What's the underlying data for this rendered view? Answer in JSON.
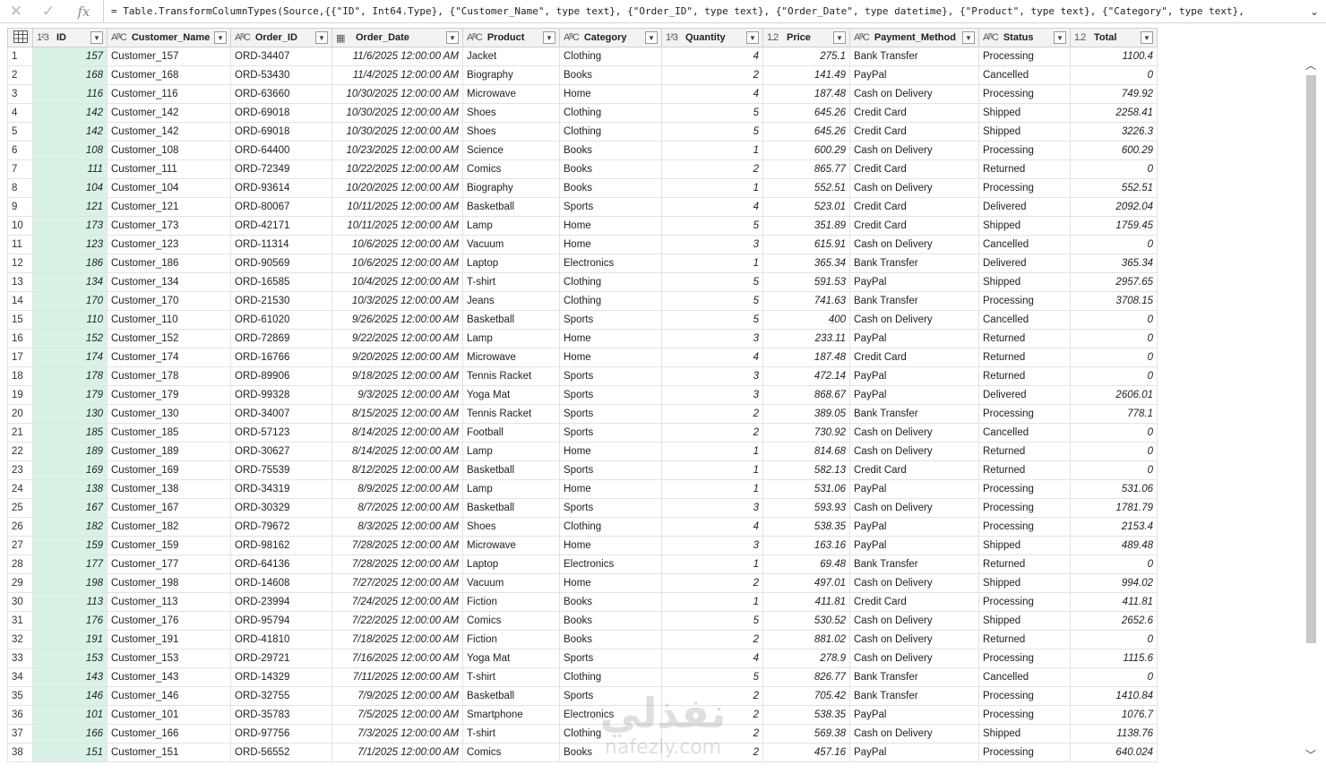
{
  "formula_bar": {
    "cancel_icon": "x-icon",
    "confirm_icon": "check-icon",
    "fx_label": "fx",
    "formula": "= Table.TransformColumnTypes(Source,{{\"ID\", Int64.Type}, {\"Customer_Name\", type text}, {\"Order_ID\", type text}, {\"Order_Date\", type datetime}, {\"Product\", type text}, {\"Category\", type text},"
  },
  "table": {
    "corner_icon": "table-icon",
    "columns": [
      {
        "name": "ID",
        "type_icon": "1²3",
        "type": "int"
      },
      {
        "name": "Customer_Name",
        "type_icon": "AᴮC",
        "type": "text"
      },
      {
        "name": "Order_ID",
        "type_icon": "AᴮC",
        "type": "text"
      },
      {
        "name": "Order_Date",
        "type_icon": "▦",
        "type": "datetime"
      },
      {
        "name": "Product",
        "type_icon": "AᴮC",
        "type": "text"
      },
      {
        "name": "Category",
        "type_icon": "AᴮC",
        "type": "text"
      },
      {
        "name": "Quantity",
        "type_icon": "1²3",
        "type": "int"
      },
      {
        "name": "Price",
        "type_icon": "1.2",
        "type": "decimal"
      },
      {
        "name": "Payment_Method",
        "type_icon": "AᴮC",
        "type": "text"
      },
      {
        "name": "Status",
        "type_icon": "AᴮC",
        "type": "text"
      },
      {
        "name": "Total",
        "type_icon": "1.2",
        "type": "decimal"
      }
    ],
    "rows": [
      [
        "1",
        "157",
        "Customer_157",
        "ORD-34407",
        "11/6/2025 12:00:00 AM",
        "Jacket",
        "Clothing",
        "4",
        "275.1",
        "Bank Transfer",
        "Processing",
        "1100.4"
      ],
      [
        "2",
        "168",
        "Customer_168",
        "ORD-53430",
        "11/4/2025 12:00:00 AM",
        "Biography",
        "Books",
        "2",
        "141.49",
        "PayPal",
        "Cancelled",
        "0"
      ],
      [
        "3",
        "116",
        "Customer_116",
        "ORD-63660",
        "10/30/2025 12:00:00 AM",
        "Microwave",
        "Home",
        "4",
        "187.48",
        "Cash on Delivery",
        "Processing",
        "749.92"
      ],
      [
        "4",
        "142",
        "Customer_142",
        "ORD-69018",
        "10/30/2025 12:00:00 AM",
        "Shoes",
        "Clothing",
        "5",
        "645.26",
        "Credit Card",
        "Shipped",
        "2258.41"
      ],
      [
        "5",
        "142",
        "Customer_142",
        "ORD-69018",
        "10/30/2025 12:00:00 AM",
        "Shoes",
        "Clothing",
        "5",
        "645.26",
        "Credit Card",
        "Shipped",
        "3226.3"
      ],
      [
        "6",
        "108",
        "Customer_108",
        "ORD-64400",
        "10/23/2025 12:00:00 AM",
        "Science",
        "Books",
        "1",
        "600.29",
        "Cash on Delivery",
        "Processing",
        "600.29"
      ],
      [
        "7",
        "111",
        "Customer_111",
        "ORD-72349",
        "10/22/2025 12:00:00 AM",
        "Comics",
        "Books",
        "2",
        "865.77",
        "Credit Card",
        "Returned",
        "0"
      ],
      [
        "8",
        "104",
        "Customer_104",
        "ORD-93614",
        "10/20/2025 12:00:00 AM",
        "Biography",
        "Books",
        "1",
        "552.51",
        "Cash on Delivery",
        "Processing",
        "552.51"
      ],
      [
        "9",
        "121",
        "Customer_121",
        "ORD-80067",
        "10/11/2025 12:00:00 AM",
        "Basketball",
        "Sports",
        "4",
        "523.01",
        "Credit Card",
        "Delivered",
        "2092.04"
      ],
      [
        "10",
        "173",
        "Customer_173",
        "ORD-42171",
        "10/11/2025 12:00:00 AM",
        "Lamp",
        "Home",
        "5",
        "351.89",
        "Credit Card",
        "Shipped",
        "1759.45"
      ],
      [
        "11",
        "123",
        "Customer_123",
        "ORD-11314",
        "10/6/2025 12:00:00 AM",
        "Vacuum",
        "Home",
        "3",
        "615.91",
        "Cash on Delivery",
        "Cancelled",
        "0"
      ],
      [
        "12",
        "186",
        "Customer_186",
        "ORD-90569",
        "10/6/2025 12:00:00 AM",
        "Laptop",
        "Electronics",
        "1",
        "365.34",
        "Bank Transfer",
        "Delivered",
        "365.34"
      ],
      [
        "13",
        "134",
        "Customer_134",
        "ORD-16585",
        "10/4/2025 12:00:00 AM",
        "T-shirt",
        "Clothing",
        "5",
        "591.53",
        "PayPal",
        "Shipped",
        "2957.65"
      ],
      [
        "14",
        "170",
        "Customer_170",
        "ORD-21530",
        "10/3/2025 12:00:00 AM",
        "Jeans",
        "Clothing",
        "5",
        "741.63",
        "Bank Transfer",
        "Processing",
        "3708.15"
      ],
      [
        "15",
        "110",
        "Customer_110",
        "ORD-61020",
        "9/26/2025 12:00:00 AM",
        "Basketball",
        "Sports",
        "5",
        "400",
        "Cash on Delivery",
        "Cancelled",
        "0"
      ],
      [
        "16",
        "152",
        "Customer_152",
        "ORD-72869",
        "9/22/2025 12:00:00 AM",
        "Lamp",
        "Home",
        "3",
        "233.11",
        "PayPal",
        "Returned",
        "0"
      ],
      [
        "17",
        "174",
        "Customer_174",
        "ORD-16766",
        "9/20/2025 12:00:00 AM",
        "Microwave",
        "Home",
        "4",
        "187.48",
        "Credit Card",
        "Returned",
        "0"
      ],
      [
        "18",
        "178",
        "Customer_178",
        "ORD-89906",
        "9/18/2025 12:00:00 AM",
        "Tennis Racket",
        "Sports",
        "3",
        "472.14",
        "PayPal",
        "Returned",
        "0"
      ],
      [
        "19",
        "179",
        "Customer_179",
        "ORD-99328",
        "9/3/2025 12:00:00 AM",
        "Yoga Mat",
        "Sports",
        "3",
        "868.67",
        "PayPal",
        "Delivered",
        "2606.01"
      ],
      [
        "20",
        "130",
        "Customer_130",
        "ORD-34007",
        "8/15/2025 12:00:00 AM",
        "Tennis Racket",
        "Sports",
        "2",
        "389.05",
        "Bank Transfer",
        "Processing",
        "778.1"
      ],
      [
        "21",
        "185",
        "Customer_185",
        "ORD-57123",
        "8/14/2025 12:00:00 AM",
        "Football",
        "Sports",
        "2",
        "730.92",
        "Cash on Delivery",
        "Cancelled",
        "0"
      ],
      [
        "22",
        "189",
        "Customer_189",
        "ORD-30627",
        "8/14/2025 12:00:00 AM",
        "Lamp",
        "Home",
        "1",
        "814.68",
        "Cash on Delivery",
        "Returned",
        "0"
      ],
      [
        "23",
        "169",
        "Customer_169",
        "ORD-75539",
        "8/12/2025 12:00:00 AM",
        "Basketball",
        "Sports",
        "1",
        "582.13",
        "Credit Card",
        "Returned",
        "0"
      ],
      [
        "24",
        "138",
        "Customer_138",
        "ORD-34319",
        "8/9/2025 12:00:00 AM",
        "Lamp",
        "Home",
        "1",
        "531.06",
        "PayPal",
        "Processing",
        "531.06"
      ],
      [
        "25",
        "167",
        "Customer_167",
        "ORD-30329",
        "8/7/2025 12:00:00 AM",
        "Basketball",
        "Sports",
        "3",
        "593.93",
        "Cash on Delivery",
        "Processing",
        "1781.79"
      ],
      [
        "26",
        "182",
        "Customer_182",
        "ORD-79672",
        "8/3/2025 12:00:00 AM",
        "Shoes",
        "Clothing",
        "4",
        "538.35",
        "PayPal",
        "Processing",
        "2153.4"
      ],
      [
        "27",
        "159",
        "Customer_159",
        "ORD-98162",
        "7/28/2025 12:00:00 AM",
        "Microwave",
        "Home",
        "3",
        "163.16",
        "PayPal",
        "Shipped",
        "489.48"
      ],
      [
        "28",
        "177",
        "Customer_177",
        "ORD-64136",
        "7/28/2025 12:00:00 AM",
        "Laptop",
        "Electronics",
        "1",
        "69.48",
        "Bank Transfer",
        "Returned",
        "0"
      ],
      [
        "29",
        "198",
        "Customer_198",
        "ORD-14608",
        "7/27/2025 12:00:00 AM",
        "Vacuum",
        "Home",
        "2",
        "497.01",
        "Cash on Delivery",
        "Shipped",
        "994.02"
      ],
      [
        "30",
        "113",
        "Customer_113",
        "ORD-23994",
        "7/24/2025 12:00:00 AM",
        "Fiction",
        "Books",
        "1",
        "411.81",
        "Credit Card",
        "Processing",
        "411.81"
      ],
      [
        "31",
        "176",
        "Customer_176",
        "ORD-95794",
        "7/22/2025 12:00:00 AM",
        "Comics",
        "Books",
        "5",
        "530.52",
        "Cash on Delivery",
        "Shipped",
        "2652.6"
      ],
      [
        "32",
        "191",
        "Customer_191",
        "ORD-41810",
        "7/18/2025 12:00:00 AM",
        "Fiction",
        "Books",
        "2",
        "881.02",
        "Cash on Delivery",
        "Returned",
        "0"
      ],
      [
        "33",
        "153",
        "Customer_153",
        "ORD-29721",
        "7/16/2025 12:00:00 AM",
        "Yoga Mat",
        "Sports",
        "4",
        "278.9",
        "Cash on Delivery",
        "Processing",
        "1115.6"
      ],
      [
        "34",
        "143",
        "Customer_143",
        "ORD-14329",
        "7/11/2025 12:00:00 AM",
        "T-shirt",
        "Clothing",
        "5",
        "826.77",
        "Bank Transfer",
        "Cancelled",
        "0"
      ],
      [
        "35",
        "146",
        "Customer_146",
        "ORD-32755",
        "7/9/2025 12:00:00 AM",
        "Basketball",
        "Sports",
        "2",
        "705.42",
        "Bank Transfer",
        "Processing",
        "1410.84"
      ],
      [
        "36",
        "101",
        "Customer_101",
        "ORD-35783",
        "7/5/2025 12:00:00 AM",
        "Smartphone",
        "Electronics",
        "2",
        "538.35",
        "PayPal",
        "Processing",
        "1076.7"
      ],
      [
        "37",
        "166",
        "Customer_166",
        "ORD-97756",
        "7/3/2025 12:00:00 AM",
        "T-shirt",
        "Clothing",
        "2",
        "569.38",
        "Cash on Delivery",
        "Shipped",
        "1138.76"
      ],
      [
        "38",
        "151",
        "Customer_151",
        "ORD-56552",
        "7/1/2025 12:00:00 AM",
        "Comics",
        "Books",
        "2",
        "457.16",
        "PayPal",
        "Processing",
        "640.024"
      ]
    ]
  },
  "scrollbar": {
    "up_icon": "chevron-up-icon",
    "down_icon": "chevron-down-icon"
  },
  "watermark": {
    "arabic": "نفذلي",
    "latin": "nafezly.com"
  },
  "colors": {
    "id_column_bg": "#d9f2e6",
    "header_bg": "#f3f3f3",
    "grid_line": "#e3e3e3"
  }
}
